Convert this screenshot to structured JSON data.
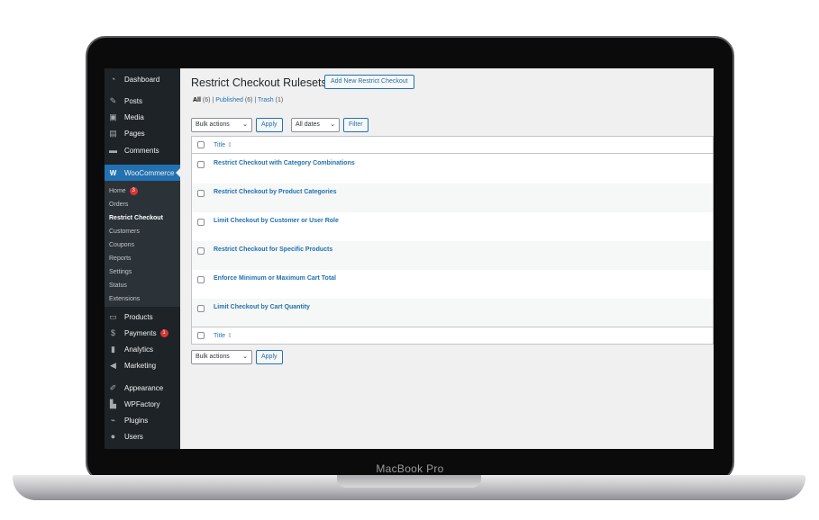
{
  "device": {
    "label": "MacBook Pro"
  },
  "sidebar": {
    "top_items": [
      {
        "label": "Dashboard",
        "icon": "dashboard-icon"
      },
      {
        "label": "Posts",
        "icon": "pin-icon"
      },
      {
        "label": "Media",
        "icon": "media-icon"
      },
      {
        "label": "Pages",
        "icon": "pages-icon"
      },
      {
        "label": "Comments",
        "icon": "comments-icon"
      }
    ],
    "woocommerce": {
      "label": "WooCommerce",
      "icon": "woocommerce-icon"
    },
    "sub_items": [
      {
        "label": "Home",
        "badge": "3"
      },
      {
        "label": "Orders"
      },
      {
        "label": "Restrict Checkout"
      },
      {
        "label": "Customers"
      },
      {
        "label": "Coupons"
      },
      {
        "label": "Reports"
      },
      {
        "label": "Settings"
      },
      {
        "label": "Status"
      },
      {
        "label": "Extensions"
      }
    ],
    "bottom_items": [
      {
        "label": "Products",
        "icon": "products-icon"
      },
      {
        "label": "Payments",
        "icon": "payments-icon",
        "badge": "1"
      },
      {
        "label": "Analytics",
        "icon": "analytics-icon"
      },
      {
        "label": "Marketing",
        "icon": "marketing-icon"
      },
      {
        "label": "Appearance",
        "icon": "appearance-icon"
      },
      {
        "label": "WPFactory",
        "icon": "wpfactory-icon"
      },
      {
        "label": "Plugins",
        "icon": "plugins-icon"
      },
      {
        "label": "Users",
        "icon": "users-icon"
      }
    ]
  },
  "page": {
    "title": "Restrict Checkout Rulesets",
    "add_new_label": "Add New Restrict Checkout",
    "filters": {
      "all": "All",
      "all_count": "(6)",
      "published": "Published",
      "published_count": "(6)",
      "trash": "Trash",
      "trash_count": "(1)"
    },
    "bulk_actions": "Bulk actions",
    "apply": "Apply",
    "all_dates": "All dates",
    "filter": "Filter",
    "column_title": "Title",
    "rows": [
      "Restrict Checkout with Category Combinations",
      "Restrict Checkout by Product Categories",
      "Limit Checkout by Customer or User Role",
      "Restrict Checkout for Specific Products",
      "Enforce Minimum or Maximum Cart Total",
      "Limit Checkout by Cart Quantity"
    ]
  },
  "colors": {
    "sidebar": "#1d2327",
    "accent": "#2271b1",
    "badge": "#d63638"
  }
}
